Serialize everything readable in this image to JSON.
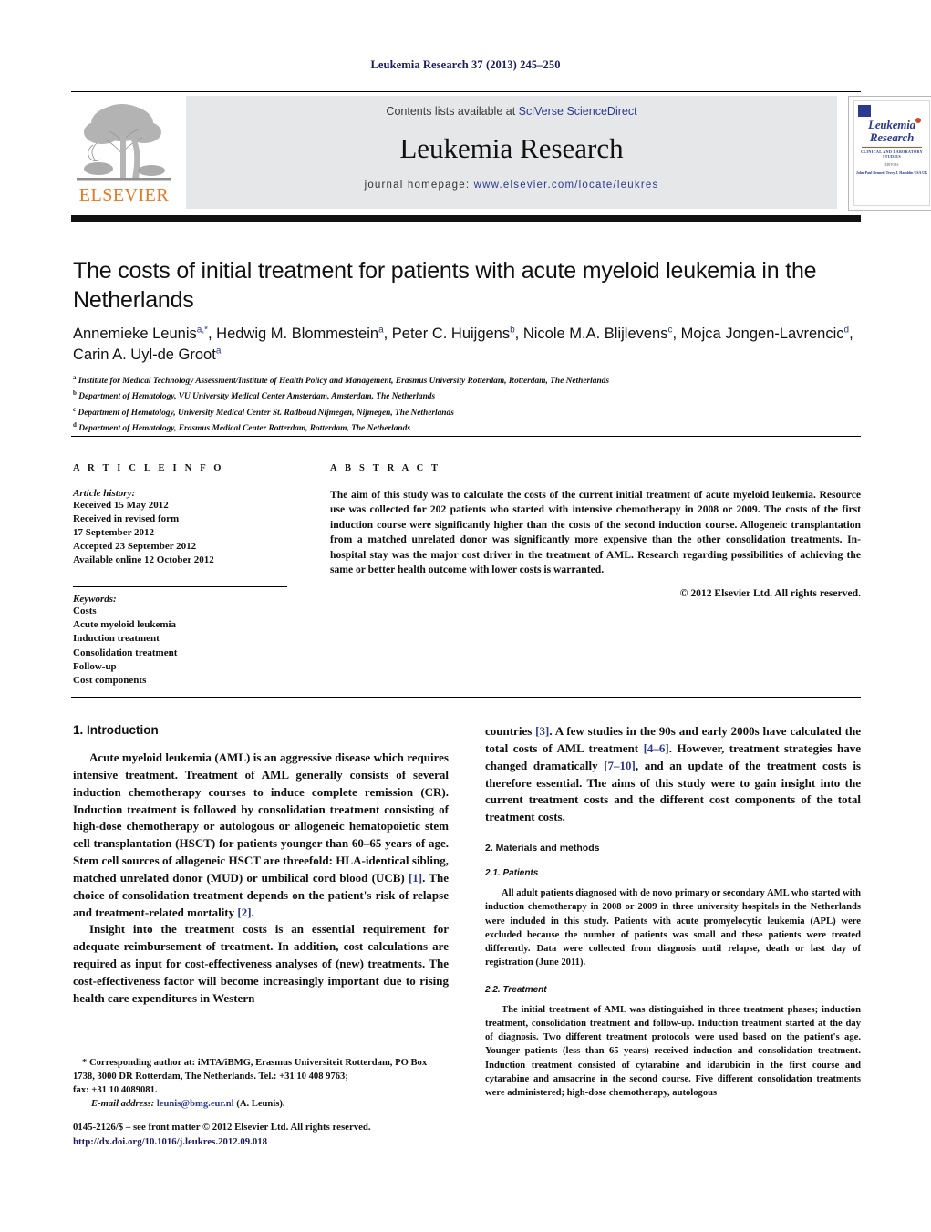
{
  "running_head": "Leukemia Research 37 (2013) 245–250",
  "masthead": {
    "contents_prefix": "Contents lists available at ",
    "sciencedirect": "SciVerse ScienceDirect",
    "journal_title": "Leukemia Research",
    "homepage_label": "journal homepage:",
    "homepage_url": "www.elsevier.com/locate/leukres",
    "publisher_logo_text": "ELSEVIER",
    "publisher_logo_icon": "elsevier-tree-icon",
    "cover": {
      "title_line1": "Leukemia",
      "title_line2": "Research",
      "subtitle": "CLINICAL AND LABORATORY STUDIES",
      "editors_label": "EDITORS",
      "editor_names": "John-Paul Bennett          Terry J. Hamblin\nUSA                                    UK"
    }
  },
  "article": {
    "title": "The costs of initial treatment for patients with acute myeloid leukemia in the Netherlands",
    "authors_html": "Annemieke Leunis<sup>a,*</sup>, Hedwig M. Blommestein<sup>a</sup>, Peter C. Huijgens<sup>b</sup>, Nicole M.A. Blijlevens<sup>c</sup>, Mojca Jongen-Lavrencic<sup>d</sup>, Carin A. Uyl-de Groot<sup>a</sup>",
    "affiliations": [
      {
        "mark": "a",
        "text": "Institute for Medical Technology Assessment/Institute of Health Policy and Management, Erasmus University Rotterdam, Rotterdam, The Netherlands"
      },
      {
        "mark": "b",
        "text": "Department of Hematology, VU University Medical Center Amsterdam, Amsterdam, The Netherlands"
      },
      {
        "mark": "c",
        "text": "Department of Hematology, University Medical Center St. Radboud Nijmegen, Nijmegen, The Netherlands"
      },
      {
        "mark": "d",
        "text": "Department of Hematology, Erasmus Medical Center Rotterdam, Rotterdam, The Netherlands"
      }
    ]
  },
  "article_info": {
    "heading": "A R T I C L E    I N F O",
    "history_label": "Article history:",
    "history": [
      "Received 15 May 2012",
      "Received in revised form",
      "17 September 2012",
      "Accepted 23 September 2012",
      "Available online 12 October 2012"
    ],
    "keywords_label": "Keywords:",
    "keywords": [
      "Costs",
      "Acute myeloid leukemia",
      "Induction treatment",
      "Consolidation treatment",
      "Follow-up",
      "Cost components"
    ]
  },
  "abstract": {
    "heading": "A B S T R A C T",
    "body": "The aim of this study was to calculate the costs of the current initial treatment of acute myeloid leukemia. Resource use was collected for 202 patients who started with intensive chemotherapy in 2008 or 2009. The costs of the first induction course were significantly higher than the costs of the second induction course. Allogeneic transplantation from a matched unrelated donor was significantly more expensive than the other consolidation treatments. In-hospital stay was the major cost driver in the treatment of AML. Research regarding possibilities of achieving the same or better health outcome with lower costs is warranted.",
    "copyright": "© 2012 Elsevier Ltd. All rights reserved."
  },
  "sections": {
    "introduction_heading": "1.  Introduction",
    "intro_p1": "Acute myeloid leukemia (AML) is an aggressive disease which requires intensive treatment. Treatment of AML generally consists of several induction chemotherapy courses to induce complete remission (CR). Induction treatment is followed by consolidation treatment consisting of high-dose chemotherapy or autologous or allogeneic hematopoietic stem cell transplantation (HSCT) for patients younger than 60–65 years of age. Stem cell sources of allogeneic HSCT are threefold: HLA-identical sibling, matched unrelated donor (MUD) or umbilical cord blood (UCB) [1]. The choice of consolidation treatment depends on the patient's risk of relapse and treatment-related mortality [2].",
    "intro_p2": "Insight into the treatment costs is an essential requirement for adequate reimbursement of treatment. In addition, cost calculations are required as input for cost-effectiveness analyses of (new) treatments. The cost-effectiveness factor will become increasingly important due to rising health care expenditures in Western",
    "intro_p2_cont": "countries [3]. A few studies in the 90s and early 2000s have calculated the total costs of AML treatment [4–6]. However, treatment strategies have changed dramatically [7–10], and an update of the treatment costs is therefore essential. The aims of this study were to gain insight into the current treatment costs and the different cost components of the total treatment costs.",
    "materials_heading": "2.  Materials and methods",
    "patients_heading": "2.1.  Patients",
    "patients_p": "All adult patients diagnosed with de novo primary or secondary AML who started with induction chemotherapy in 2008 or 2009 in three university hospitals in the Netherlands were included in this study. Patients with acute promyelocytic leukemia (APL) were excluded because the number of patients was small and these patients were treated differently. Data were collected from diagnosis until relapse, death or last day of registration (June 2011).",
    "treatment_heading": "2.2.  Treatment",
    "treatment_p": "The initial treatment of AML was distinguished in three treatment phases; induction treatment, consolidation treatment and follow-up. Induction treatment started at the day of diagnosis. Two different treatment protocols were used based on the patient's age. Younger patients (less than 65 years) received induction and consolidation treatment. Induction treatment consisted of cytarabine and idarubicin in the first course and cytarabine and amsacrine in the second course. Five different consolidation treatments were administered; high-dose chemotherapy, autologous"
  },
  "footnote": {
    "line1": "* Corresponding author at: iMTA/iBMG, Erasmus Universiteit Rotterdam, PO Box",
    "line2": "1738, 3000 DR Rotterdam, The Netherlands. Tel.: +31 10 408 9763;",
    "line3": "fax: +31 10 4089081.",
    "email_label": "E-mail address:",
    "email": "leunis@bmg.eur.nl",
    "email_suffix": "(A. Leunis)."
  },
  "imprint": {
    "line1": "0145-2126/$ – see front matter © 2012 Elsevier Ltd. All rights reserved.",
    "doi": "http://dx.doi.org/10.1016/j.leukres.2012.09.018"
  },
  "colors": {
    "link_blue": "#2b3a8f",
    "elsevier_orange": "#E87722",
    "banner_gray": "#e6e7e9",
    "runhead_navy": "#1b1b64"
  }
}
